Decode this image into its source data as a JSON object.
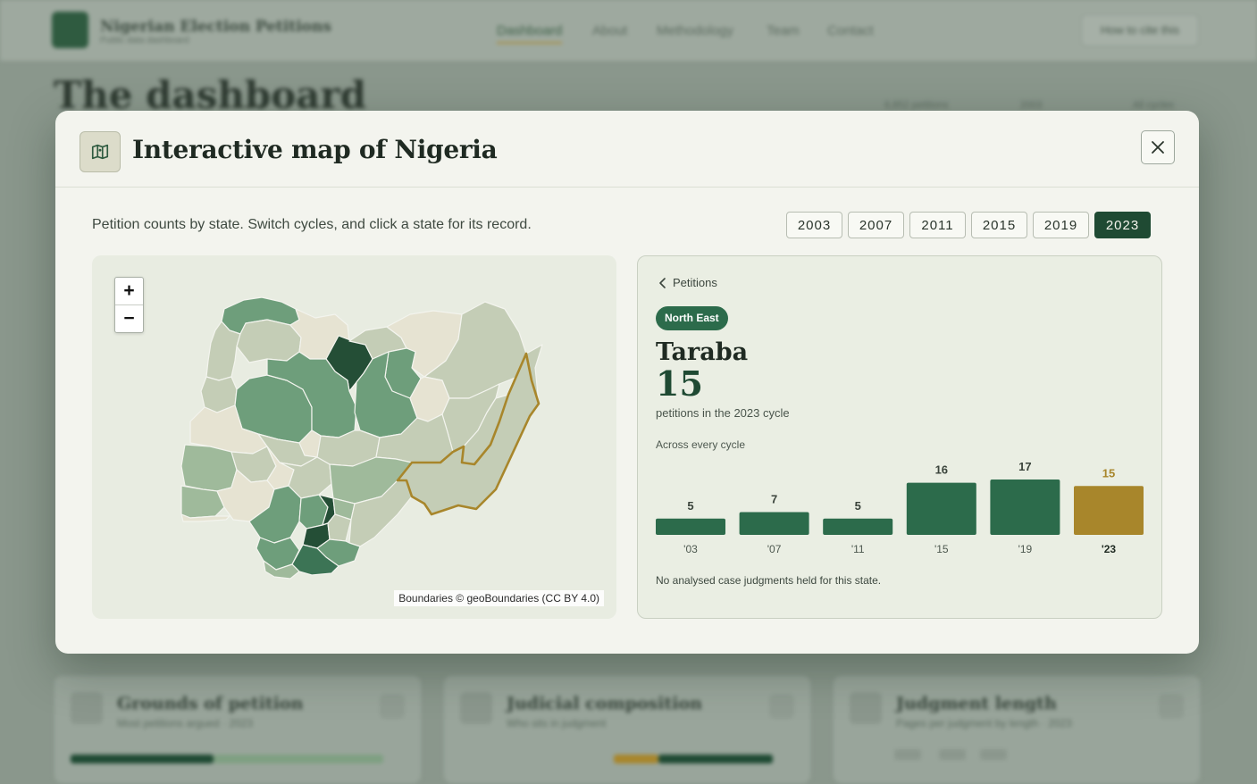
{
  "background": {
    "brand": "Nigerian Election Petitions",
    "brand_sub": "Public data dashboard",
    "nav": [
      "Dashboard",
      "About",
      "Methodology",
      "Team",
      "Contact"
    ],
    "cta": "How to cite this",
    "page_title": "The dashboard",
    "meta": [
      "6,852 petitions",
      "2003",
      "All cycles"
    ],
    "cards": [
      {
        "title": "Grounds of petition",
        "sub": "Most petitions argued · 2023"
      },
      {
        "title": "Judicial composition",
        "sub": "Who sits in judgment"
      },
      {
        "title": "Judgment length",
        "sub": "Pages per judgment by length · 2023"
      }
    ]
  },
  "modal": {
    "title": "Interactive map of Nigeria",
    "intro": "Petition counts by state. Switch cycles, and click a state for its record.",
    "years": [
      "2003",
      "2007",
      "2011",
      "2015",
      "2019",
      "2023"
    ],
    "selected_year": "2023",
    "close_icon": "close-icon",
    "map_icon": "map-icon"
  },
  "map": {
    "zoom_in": "+",
    "zoom_out": "−",
    "attribution": "Boundaries © geoBoundaries (CC BY 4.0)",
    "selected_state": "Taraba",
    "colors": {
      "pale": "#e6e3d2",
      "light": "#c4cdb6",
      "mid_light": "#9fba9b",
      "mid": "#6e9e7b",
      "dark": "#3c7455",
      "darkest": "#244e36",
      "highlight_outline": "#a8862b"
    }
  },
  "state": {
    "back_label": "Petitions",
    "region": "North East",
    "name": "Taraba",
    "count": "15",
    "caption": "petitions in the 2023 cycle",
    "across_label": "Across every cycle",
    "footnote": "No analysed case judgments held for this state."
  },
  "chart_data": {
    "type": "bar",
    "categories": [
      "'03",
      "'07",
      "'11",
      "'15",
      "'19",
      "'23"
    ],
    "values": [
      5,
      7,
      5,
      16,
      17,
      15
    ],
    "highlight_index": 5,
    "colors": {
      "bar": "#2c6b4b",
      "highlight": "#a8862b",
      "label": "#3a433b",
      "highlight_label": "#a8862b"
    },
    "ylim": [
      0,
      17
    ]
  }
}
